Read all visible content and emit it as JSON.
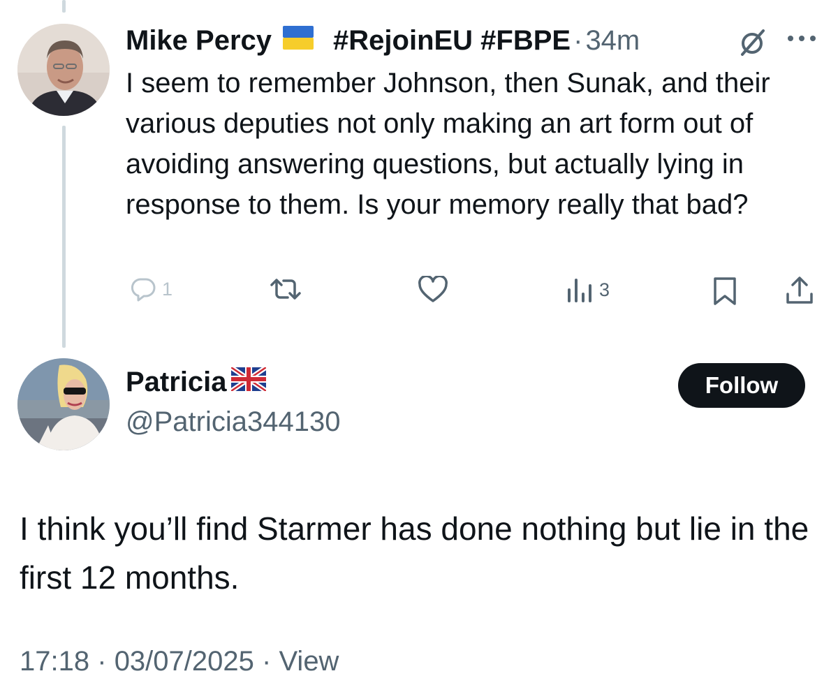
{
  "tweets": [
    {
      "author_name": "Mike Percy",
      "author_flag": "ukraine-flag",
      "hashtags": "#RejoinEU #FBPE",
      "separator": "·",
      "time": "34m",
      "text": "I seem to remember Johnson, then Sunak, and their various deputies not only making an art form out of avoiding answering questions, but actually lying in response to them. Is your memory really that bad?",
      "actions": {
        "reply": {
          "icon": "reply-icon",
          "count": "1"
        },
        "retweet": {
          "icon": "retweet-icon",
          "count": ""
        },
        "like": {
          "icon": "heart-icon",
          "count": ""
        },
        "views": {
          "icon": "analytics-icon",
          "count": "3"
        },
        "bookmark": {
          "icon": "bookmark-icon"
        },
        "share": {
          "icon": "share-icon"
        }
      }
    }
  ],
  "main_tweet": {
    "author_name": "Patricia",
    "author_flag": "uk-flag",
    "handle": "@Patricia344130",
    "follow_label": "Follow",
    "text": "I think you’ll find Starmer has done nothing but lie in the first 12 months.",
    "time": "17:18",
    "date": "03/07/2025",
    "separator": "·",
    "view_label": "View"
  },
  "colors": {
    "text_primary": "#0f1419",
    "text_secondary": "#536471",
    "thread_line": "#cfd9de",
    "follow_bg": "#0f1419"
  }
}
